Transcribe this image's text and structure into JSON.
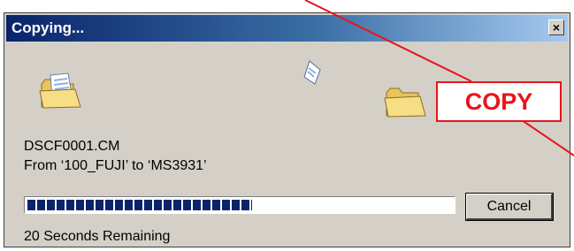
{
  "dialog": {
    "title": "Copying...",
    "close_symbol": "×",
    "file_name": "DSCF0001.CM",
    "from_to": "From ‘100_FUJI’ to ‘MS3931’",
    "progress_fraction": 0.53,
    "cancel_label": "Cancel",
    "time_remaining": "20 Seconds Remaining"
  },
  "icons": {
    "source": "open-folder-icon",
    "paper": "flying-paper-icon",
    "destination": "folder-icon"
  },
  "annotation": {
    "label": "COPY",
    "color": "#e8141c"
  },
  "colors": {
    "dialog_bg": "#d4d0c8",
    "title_start": "#0a246a",
    "title_end": "#a6caf0",
    "progress_block": "#0a246a"
  }
}
